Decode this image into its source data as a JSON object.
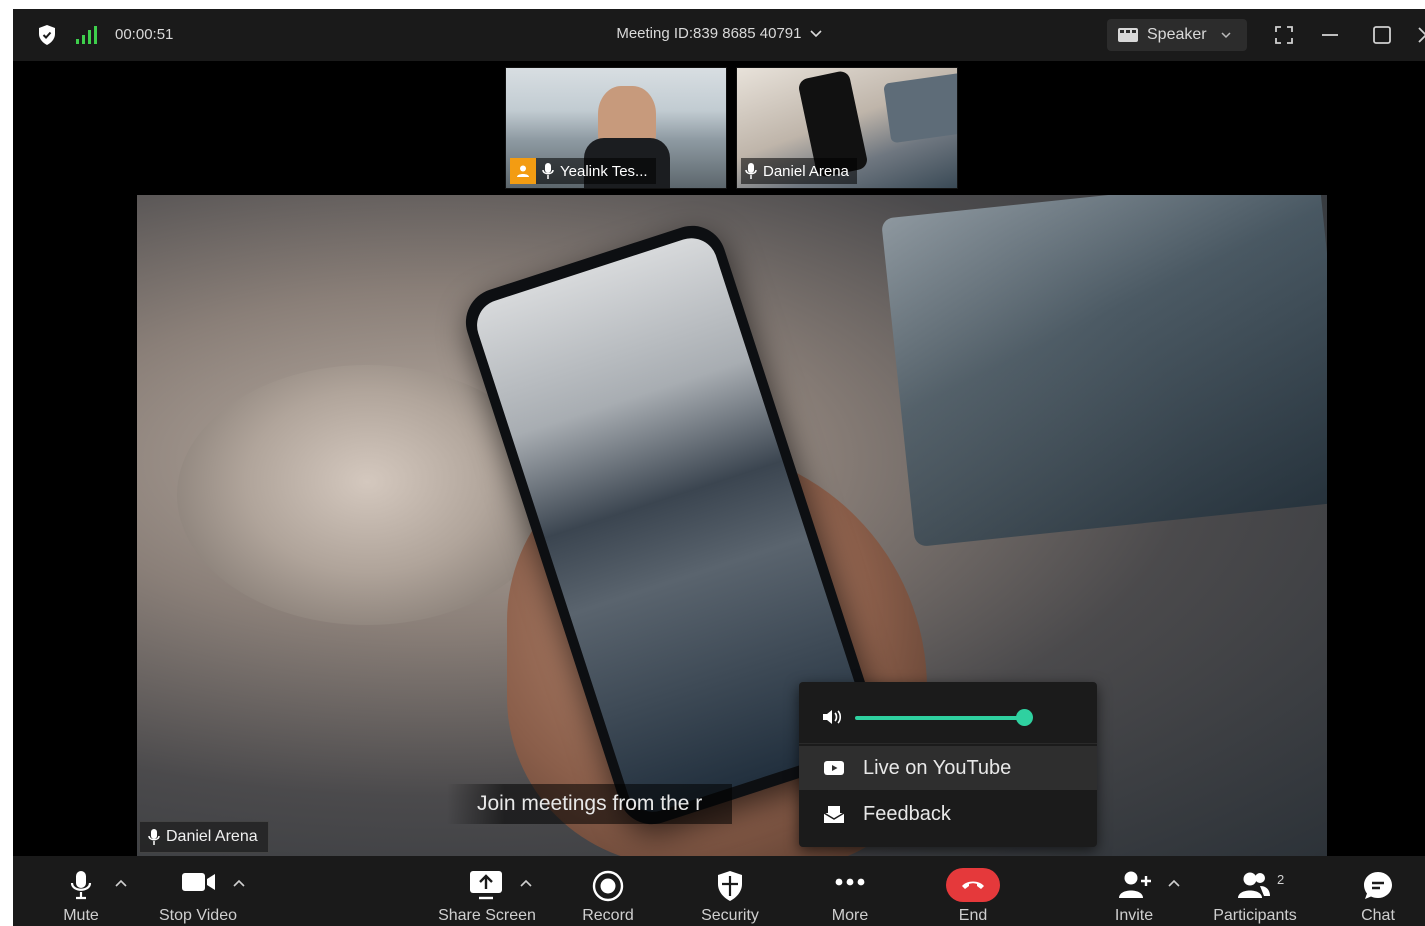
{
  "topbar": {
    "timer": "00:00:51",
    "meeting_id": "Meeting ID:839 8685 40791",
    "speaker_label": "Speaker"
  },
  "thumbnails": [
    {
      "name": "Yealink Tes..."
    },
    {
      "name": "Daniel Arena"
    }
  ],
  "main_video": {
    "subtitle": "Join meetings from the r",
    "speaker_name": "Daniel Arena"
  },
  "popup": {
    "volume_level": 0.95,
    "items": [
      {
        "label": "Live on YouTube"
      },
      {
        "label": "Feedback"
      }
    ]
  },
  "toolbar": {
    "mute": "Mute",
    "stop_video": "Stop Video",
    "share_screen": "Share Screen",
    "record": "Record",
    "security": "Security",
    "more": "More",
    "end": "End",
    "invite": "Invite",
    "participants": "Participants",
    "participants_count": "2",
    "chat": "Chat"
  },
  "colors": {
    "accent_green": "#2fd1a0",
    "end_red": "#e5393b",
    "signal_green": "#3ecf4c",
    "badge_orange": "#f39c12"
  }
}
